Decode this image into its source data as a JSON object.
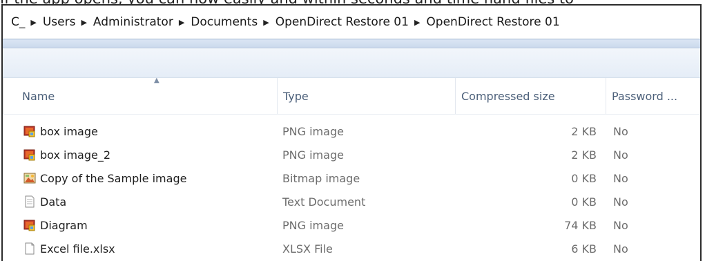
{
  "top_caption": "If the app opens, you can now easily and within seconds and time hand files to",
  "address": {
    "crumbs": [
      "C_",
      "Users",
      "Administrator",
      "Documents",
      "OpenDirect Restore 01",
      "OpenDirect Restore 01"
    ]
  },
  "columns": {
    "name": "Name",
    "type": "Type",
    "size": "Compressed size",
    "password": "Password ..."
  },
  "files": [
    {
      "name": "box image",
      "type": "PNG image",
      "size": "2 KB",
      "password": "No",
      "icon": "png-image-icon"
    },
    {
      "name": "box image_2",
      "type": "PNG image",
      "size": "2 KB",
      "password": "No",
      "icon": "png-image-icon"
    },
    {
      "name": "Copy of the Sample image",
      "type": "Bitmap image",
      "size": "0 KB",
      "password": "No",
      "icon": "bitmap-image-icon"
    },
    {
      "name": "Data",
      "type": "Text Document",
      "size": "0 KB",
      "password": "No",
      "icon": "text-document-icon"
    },
    {
      "name": "Diagram",
      "type": "PNG image",
      "size": "74 KB",
      "password": "No",
      "icon": "png-image-icon"
    },
    {
      "name": "Excel file.xlsx",
      "type": "XLSX File",
      "size": "6 KB",
      "password": "No",
      "icon": "file-icon"
    }
  ]
}
